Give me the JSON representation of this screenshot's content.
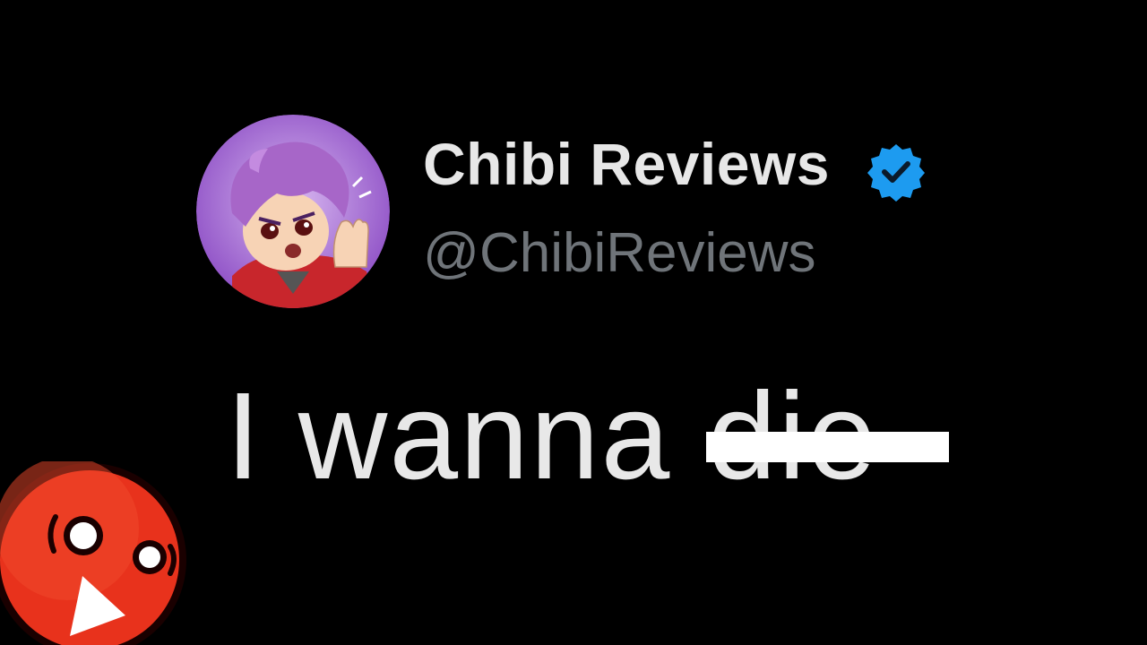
{
  "profile": {
    "display_name": "Chibi Reviews",
    "handle": "@ChibiReviews",
    "verified": true,
    "avatar_icon": "chibi-avatar-icon",
    "badge_color": "#1d9bf0"
  },
  "tweet": {
    "text": "I wanna die",
    "visible_text": "I wanna ",
    "struck_text": "die"
  },
  "overlay": {
    "mascot_icon": "red-ball-mascot-icon",
    "mascot_color": "#e8321c"
  },
  "colors": {
    "background": "#000000",
    "name": "#e7e7e7",
    "handle": "#6f7479",
    "tweet": "#e8e8e8"
  }
}
